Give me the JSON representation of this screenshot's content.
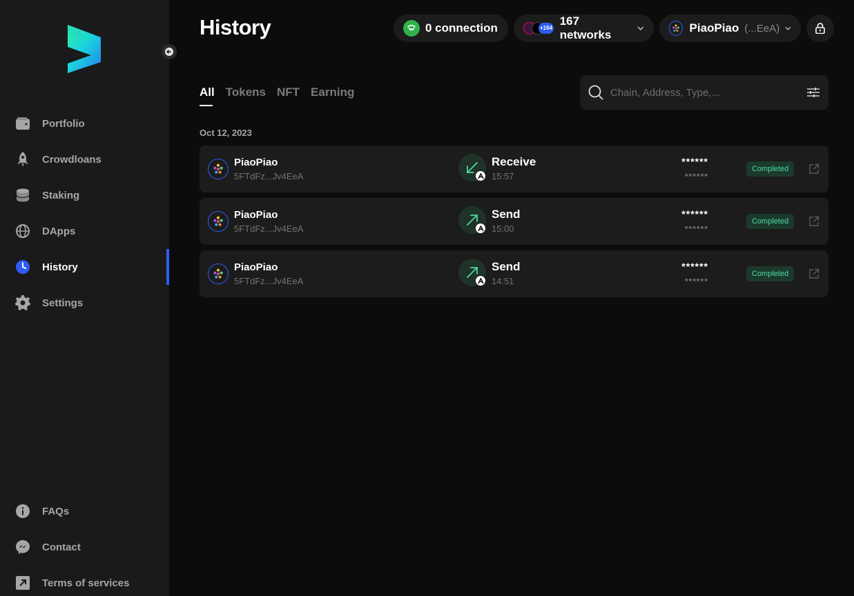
{
  "sidebar": {
    "nav_items": [
      {
        "label": "Portfolio",
        "icon": "wallet-icon"
      },
      {
        "label": "Crowdloans",
        "icon": "rocket-icon"
      },
      {
        "label": "Staking",
        "icon": "database-icon"
      },
      {
        "label": "DApps",
        "icon": "globe-icon"
      },
      {
        "label": "History",
        "icon": "clock-icon",
        "active": true
      },
      {
        "label": "Settings",
        "icon": "gear-icon"
      }
    ],
    "footer_items": [
      {
        "label": "FAQs",
        "icon": "info-icon"
      },
      {
        "label": "Contact",
        "icon": "messenger-icon"
      },
      {
        "label": "Terms of services",
        "icon": "external-square-icon"
      }
    ]
  },
  "header": {
    "title": "History",
    "connection": "0 connection",
    "networks_badge": "+164",
    "networks": "167 networks",
    "account_name": "PiaoPiao",
    "account_short": "(...EeA)"
  },
  "tabs": [
    "All",
    "Tokens",
    "NFT",
    "Earning"
  ],
  "active_tab": "All",
  "search": {
    "placeholder": "Chain, Address, Type,..."
  },
  "groups": [
    {
      "date": "Oct 12, 2023",
      "transactions": [
        {
          "account": "PiaoPiao",
          "address": "5FTdFz...Jv4EeA",
          "type": "Receive",
          "direction": "in",
          "time": "15:57",
          "amount": "******",
          "fee": "******",
          "status": "Completed"
        },
        {
          "account": "PiaoPiao",
          "address": "5FTdFz...Jv4EeA",
          "type": "Send",
          "direction": "out",
          "time": "15:00",
          "amount": "******",
          "fee": "******",
          "status": "Completed"
        },
        {
          "account": "PiaoPiao",
          "address": "5FTdFz...Jv4EeA",
          "type": "Send",
          "direction": "out",
          "time": "14:51",
          "amount": "******",
          "fee": "******",
          "status": "Completed"
        }
      ]
    }
  ],
  "colors": {
    "accent": "#2f5cf5",
    "status_text": "#4cd9ac",
    "status_bg": "#1c3a2c",
    "tx_icon": "#4cd9ac",
    "connection_icon": "#2fb24c"
  }
}
